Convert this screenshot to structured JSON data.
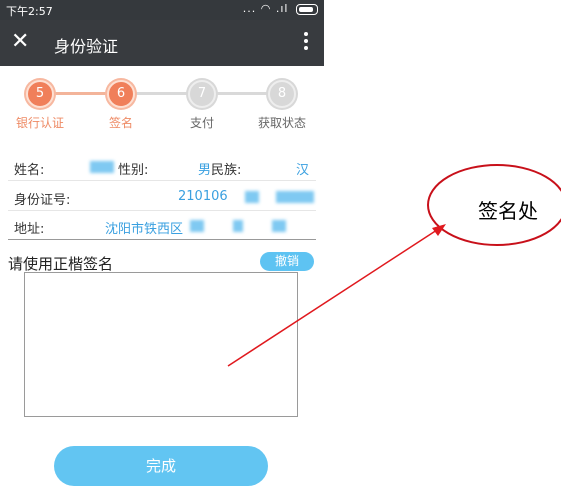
{
  "status_bar": {
    "time": "下午2:57",
    "icons": "... ◠ .ıl"
  },
  "header": {
    "title": "身份验证",
    "close_icon": "close-icon",
    "more_icon": "more-vertical-icon"
  },
  "steps": [
    {
      "number": "5",
      "label": "银行认证",
      "state": "done"
    },
    {
      "number": "6",
      "label": "签名",
      "state": "active"
    },
    {
      "number": "7",
      "label": "支付",
      "state": "todo"
    },
    {
      "number": "8",
      "label": "获取状态",
      "state": "todo"
    }
  ],
  "info": {
    "name_label": "姓名:",
    "gender_label": "性别:",
    "gender_value": "男",
    "ethnicity_label": "民族:",
    "ethnicity_value": "汉",
    "id_label": "身份证号:",
    "id_value": "210106",
    "address_label": "地址:",
    "address_value": "沈阳市铁西区"
  },
  "signature": {
    "prompt": "请使用正楷签名",
    "undo_label": "撤销"
  },
  "footer": {
    "done_label": "完成"
  },
  "annotation": {
    "callout_text": "签名处",
    "arrow_color": "#e0191e",
    "ellipse_color": "#c8101a"
  },
  "colors": {
    "accent": "#5ec3f2",
    "step_active": "#f07f5a",
    "link": "#3aa0e0"
  }
}
